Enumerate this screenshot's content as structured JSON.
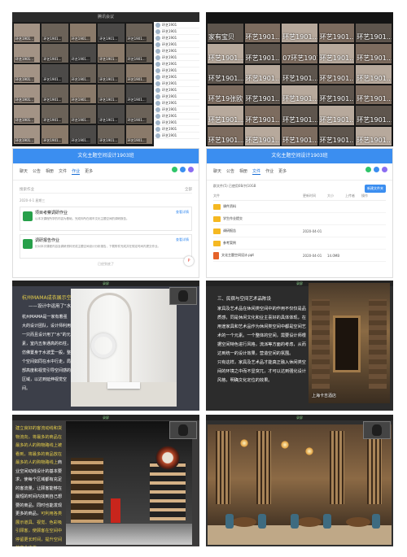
{
  "panel1": {
    "title": "腾讯会议",
    "tiles": [
      "环艺1901...",
      "环艺1901...",
      "环艺1901...",
      "环艺1901...",
      "环艺1901...",
      "环艺1901...",
      "环艺1901...",
      "环艺1901...",
      "环艺1901...",
      "环艺1901...",
      "环艺1901...",
      "环艺1901...",
      "环艺1901...",
      "环艺1901...",
      "环艺1901...",
      "环艺1901...",
      "环艺1901...",
      "环艺1901...",
      "环艺1901...",
      "环艺1901...",
      "环艺1901...",
      "环艺1901...",
      "环艺1901...",
      "环艺1901...",
      "环艺1901...",
      "环艺1901...",
      "环艺1901...",
      "环艺1901...",
      "环艺1901...",
      "环艺1901..."
    ],
    "participants": [
      "环艺1901",
      "环艺1901",
      "环艺1901",
      "环艺1901",
      "环艺1901",
      "环艺1901",
      "环艺1901",
      "环艺1901",
      "环艺1901",
      "环艺1901",
      "环艺1901",
      "环艺1901",
      "环艺1901",
      "环艺1901",
      "环艺1901",
      "环艺1901",
      "环艺1901",
      "环艺1901"
    ]
  },
  "panel2": {
    "tiles": [
      "家有宝贝",
      "环艺1901...",
      "环艺1901...",
      "环艺1901...",
      "环艺1901...",
      "环艺1901...",
      "环艺1901...",
      "07环艺1901...",
      "环艺1901...",
      "环艺1901...",
      "环艺1901...",
      "环艺1901...",
      "环艺1901...",
      "环艺1901...",
      "环艺1901...",
      "环艺19张欧...",
      "环艺1901...",
      "环艺1901...",
      "环艺1901...",
      "环艺1901...",
      "环艺1901...",
      "环艺1901...",
      "环艺1901...",
      "环艺1901...",
      "环艺1901...",
      "环艺1901...",
      "环艺1901...",
      "环艺1901...",
      "环艺1901...",
      "环艺1901..."
    ]
  },
  "panel3": {
    "title": "文化主题空间设计1903班",
    "tabs": [
      "聊天",
      "公告",
      "相册",
      "文件",
      "作业",
      "更多"
    ],
    "active_tab": "作业",
    "search_placeholder": "搜索作业",
    "filter_label": "全部",
    "date": "2020-4-1 星期三",
    "items": [
      {
        "title": "项目考察调研作业",
        "desc": "以本次课程所学的内容为基础，完成你所在城市文化主题空间的调研报告。",
        "view": "查看详情"
      },
      {
        "title": "调研报告作业",
        "desc": "针对本次课程内容及调研资料完成主题空间设计分析报告，下载附件完成并在规定时间内提交作业。",
        "view": "查看详情"
      }
    ],
    "no_more": "已经到底了"
  },
  "panel4": {
    "title": "文化主题空间设计1903班",
    "tabs": [
      "聊天",
      "公告",
      "相册",
      "文件",
      "作业",
      "更多"
    ],
    "active_tab": "文件",
    "breadcrumb": "群文件(5) 已使用0B/共10GB",
    "new_button": "新建文件夹",
    "headers": [
      "文件",
      "更新时间",
      "大小",
      "上传者",
      "操作"
    ],
    "files": [
      {
        "name": "课件资料",
        "time": "",
        "size": "",
        "user": "",
        "kind": "folder"
      },
      {
        "name": "学生作业提交",
        "time": "",
        "size": "",
        "user": "",
        "kind": "folder"
      },
      {
        "name": "调研报告",
        "time": "2020-04-01",
        "size": "",
        "user": "",
        "kind": "folder"
      },
      {
        "name": "参考案例",
        "time": "",
        "size": "",
        "user": "",
        "kind": "folder"
      },
      {
        "name": "文化主题空间设计.ppt",
        "time": "2020-04-01",
        "size": "14.0MB",
        "user": "",
        "kind": "ppt"
      }
    ]
  },
  "panel5": {
    "title": "杭州MAMA成衣展示空间设计",
    "subtitle": "——设计中运用了\"水\"的元素",
    "body": "杭州MAMA是一家有着强大的设计团队，设计师利用一只而且设计用了\"水\"的元素，室内五条通高的石柱，仿佛置身于水波里一般，整个空间如同在水中行走，局部高度和视觉引导空间感的区域，以达到延伸视觉空间。"
  },
  "panel6": {
    "heading": "三、民宿与空间艺术品陈设",
    "body": "家具及艺术品在休闲类空间中的作用不仅仅是品质感，同是休闲文化和业主喜好的具体体现，在用途家具和艺术品作为休闲类空间中都是空间艺术的一个元素。一个整体的空间，需要设计师根据空间特色进行风格，流派等方面的考虑，从而达到统一的设计效果，营造空间的氛围。",
    "body2": "只有这样，家具及艺术品才能真正融入休闲类空间的环境之中而不显突兀，才可以达到强化设计风格，明确文化定位的效果。",
    "caption": "上海卡吉酒店"
  },
  "panel7": {
    "body_pre": "建立良好的客流动线和货物流向，将最多的商品在最多的人的购物路线上被看到，",
    "body_mid": "将最多的商品放在最多的人的购物路线上",
    "body_rest": "商业空间动线设计的基本要求，使每个区域都有充足的客流量，让顾客能够在最短的时间内找到自己想要的商品，同时也能发现更多的商品，",
    "body_hl": "可利用各类展示道具、视觉、色彩吸引顾客，使顾客在空间中停留更长时间，提升空间的商业价值。"
  },
  "panel8": {},
  "watermark": "录屏"
}
